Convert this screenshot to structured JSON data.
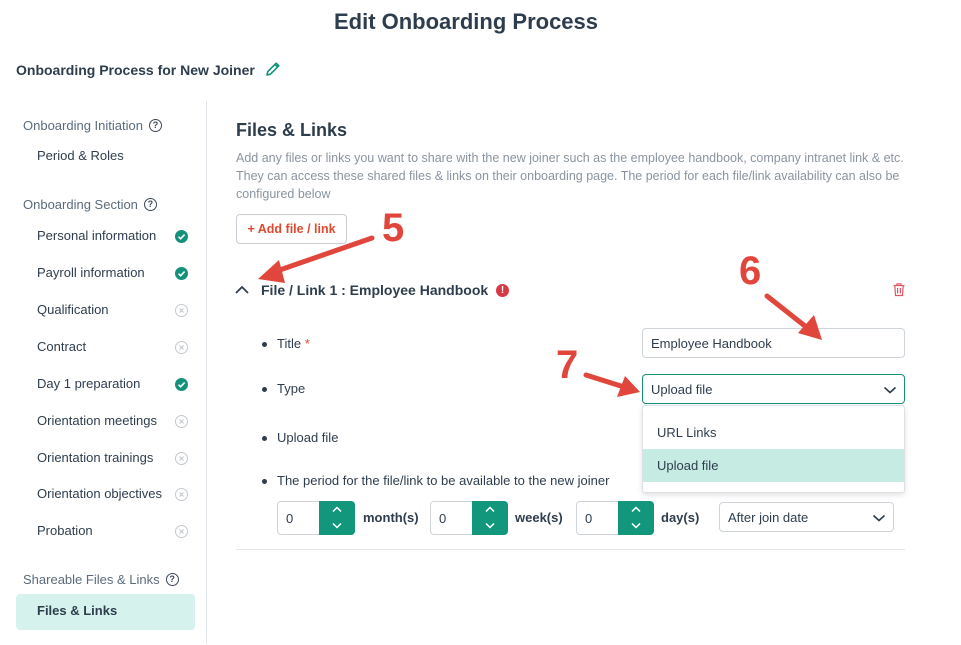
{
  "header": {
    "title": "Edit Onboarding Process",
    "process_name": "Onboarding Process for New Joiner"
  },
  "sidebar": {
    "groups": [
      {
        "label": "Onboarding Initiation",
        "items": [
          {
            "label": "Period & Roles",
            "status": "none"
          }
        ]
      },
      {
        "label": "Onboarding Section",
        "items": [
          {
            "label": "Personal information",
            "status": "done"
          },
          {
            "label": "Payroll information",
            "status": "done"
          },
          {
            "label": "Qualification",
            "status": "pending"
          },
          {
            "label": "Contract",
            "status": "pending"
          },
          {
            "label": "Day 1 preparation",
            "status": "done"
          },
          {
            "label": "Orientation meetings",
            "status": "pending"
          },
          {
            "label": "Orientation trainings",
            "status": "pending"
          },
          {
            "label": "Orientation objectives",
            "status": "pending"
          },
          {
            "label": "Probation",
            "status": "pending"
          }
        ]
      },
      {
        "label": "Shareable Files & Links",
        "items": [
          {
            "label": "Files & Links",
            "status": "active"
          }
        ]
      }
    ]
  },
  "main": {
    "section_title": "Files & Links",
    "description": "Add any files or links you want to share with the new joiner such as the employee handbook, company intranet link & etc. They can access these shared files & links on their onboarding page. The period for each file/link availability can also be configured below",
    "add_button": "+ Add file / link",
    "file_item": {
      "header": "File / Link 1 : Employee Handbook",
      "warning_icon": "!",
      "fields": {
        "title_label": "Title",
        "required_mark": "*",
        "title_value": "Employee Handbook",
        "type_label": "Type",
        "type_value": "Upload file",
        "type_options": [
          "URL Links",
          "Upload file"
        ],
        "upload_label": "Upload file",
        "period_label": "The period for the file/link to be available to the new joiner",
        "months_value": "0",
        "months_unit": "month(s)",
        "weeks_value": "0",
        "weeks_unit": "week(s)",
        "days_value": "0",
        "days_unit": "day(s)",
        "relative_to": "After join date"
      }
    }
  },
  "annotations": [
    "5",
    "6",
    "7"
  ],
  "colors": {
    "accent": "#14917a",
    "accent_light": "#d5f3ec",
    "danger": "#e0492d",
    "annotation": "#e0463b"
  },
  "icons": [
    "pencil-icon",
    "help-icon",
    "check-circle-icon",
    "x-circle-icon",
    "chevron-up-icon",
    "chevron-down-icon",
    "trash-icon",
    "warning-icon"
  ]
}
